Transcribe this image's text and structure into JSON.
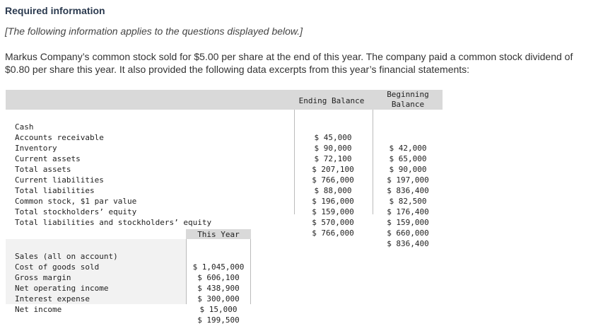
{
  "heading": "Required information",
  "subheading": "[The following information applies to the questions displayed below.]",
  "paragraph": "Markus Company’s common stock sold for $5.00 per share at the end of this year. The company paid a common stock dividend of $0.80 per share this year. It also provided the following data excerpts from this year’s financial statements:",
  "balance_table": {
    "header_ending": "Ending Balance",
    "header_beginning_line1": "Beginning",
    "header_beginning_line2": "Balance",
    "rows": [
      {
        "label": "Cash",
        "ending": "$ 45,000",
        "beginning": "$ 42,000"
      },
      {
        "label": "Accounts receivable",
        "ending": "$ 90,000",
        "beginning": "$ 65,000"
      },
      {
        "label": "Inventory",
        "ending": "$ 72,100",
        "beginning": "$ 90,000"
      },
      {
        "label": "Current assets",
        "ending": "$ 207,100",
        "beginning": "$ 197,000"
      },
      {
        "label": "Total assets",
        "ending": "$ 766,000",
        "beginning": "$ 836,400"
      },
      {
        "label": "Current liabilities",
        "ending": "$ 88,000",
        "beginning": "$ 82,500"
      },
      {
        "label": "Total liabilities",
        "ending": "$ 196,000",
        "beginning": "$ 176,400"
      },
      {
        "label": "Common stock, $1 par value",
        "ending": "$ 159,000",
        "beginning": "$ 159,000"
      },
      {
        "label": "Total stockholders’ equity",
        "ending": "$ 570,000",
        "beginning": "$ 660,000"
      },
      {
        "label": "Total liabilities and stockholders’ equity",
        "ending": "$ 766,000",
        "beginning": "$ 836,400"
      }
    ]
  },
  "income_table": {
    "header": "This Year",
    "rows": [
      {
        "label": "Sales (all on account)",
        "value": "$ 1,045,000"
      },
      {
        "label": "Cost of goods sold",
        "value": "$ 606,100"
      },
      {
        "label": "Gross margin",
        "value": "$ 438,900"
      },
      {
        "label": "Net operating income",
        "value": "$ 300,000"
      },
      {
        "label": "Interest expense",
        "value": "$ 15,000"
      },
      {
        "label": "Net income",
        "value": "$ 199,500"
      }
    ]
  },
  "colors": {
    "heading": "#2b3a4f",
    "header_bg": "#d9d9d9",
    "row_bg": "#f2f2f2"
  }
}
